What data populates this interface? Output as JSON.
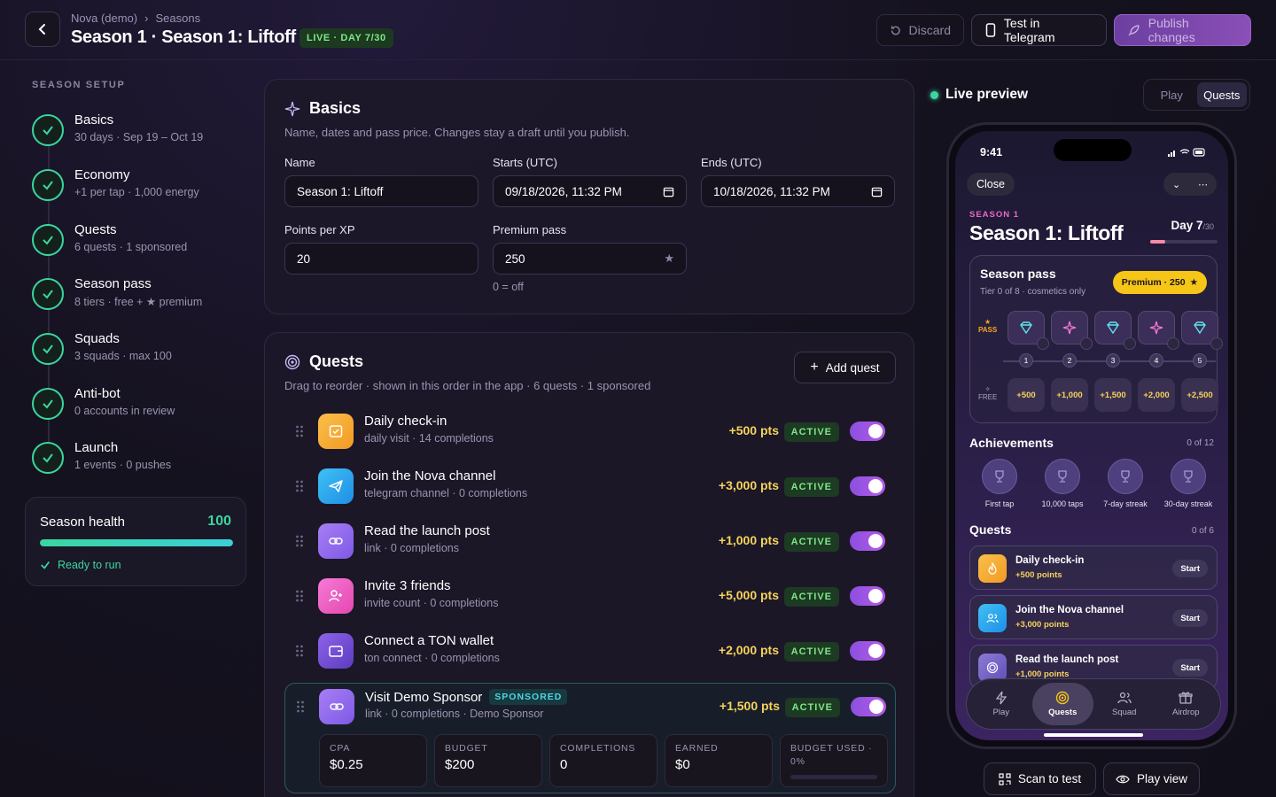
{
  "header": {
    "breadcrumb": [
      "Nova (demo)",
      "Seasons"
    ],
    "title": "Season 1 · Season 1: Liftoff",
    "status_badge": "LIVE · DAY 7/30",
    "discard_label": "Discard",
    "telegram_label": "Test in Telegram",
    "publish_label": "Publish changes"
  },
  "sidebar": {
    "section_label": "SEASON SETUP",
    "steps": [
      {
        "title": "Basics",
        "subtitle": "30 days · Sep 19 – Oct 19"
      },
      {
        "title": "Economy",
        "subtitle": "+1 per tap · 1,000 energy"
      },
      {
        "title": "Quests",
        "subtitle": "6 quests · 1 sponsored"
      },
      {
        "title": "Season pass",
        "subtitle": "8 tiers · free + ★ premium"
      },
      {
        "title": "Squads",
        "subtitle": "3 squads · max 100"
      },
      {
        "title": "Anti-bot",
        "subtitle": "0 accounts in review"
      },
      {
        "title": "Launch",
        "subtitle": "1 events · 0 pushes"
      }
    ],
    "health": {
      "label": "Season health",
      "value": "100",
      "progress": 1.0,
      "status": "Ready to run"
    }
  },
  "basics": {
    "title": "Basics",
    "subtitle": "Name, dates and pass price. Changes stay a draft until you publish.",
    "name_label": "Name",
    "name_value": "Season 1: Liftoff",
    "starts_label": "Starts (UTC)",
    "starts_value": "09/18/2026, 11:32 PM",
    "ends_label": "Ends (UTC)",
    "ends_value": "10/18/2026, 11:32 PM",
    "ppx_label": "Points per XP",
    "ppx_value": "20",
    "premium_label": "Premium pass",
    "premium_value": "250",
    "premium_hint": "0 = off"
  },
  "quests": {
    "title": "Quests",
    "subtitle": "Drag to reorder · shown in this order in the app · 6 quests · 1 sponsored",
    "add_label": "Add quest",
    "items": [
      {
        "title": "Daily check-in",
        "subtitle": "daily visit · 14 completions",
        "points": "+500 pts",
        "status": "ACTIVE",
        "icon": "calendar-icon",
        "color": "#f5a623"
      },
      {
        "title": "Join the Nova channel",
        "subtitle": "telegram channel · 0 completions",
        "points": "+3,000 pts",
        "status": "ACTIVE",
        "icon": "telegram-icon",
        "color": "#2ea6ef"
      },
      {
        "title": "Read the launch post",
        "subtitle": "link · 0 completions",
        "points": "+1,000 pts",
        "status": "ACTIVE",
        "icon": "link-icon",
        "color": "#9b6cf0"
      },
      {
        "title": "Invite 3 friends",
        "subtitle": "invite count · 0 completions",
        "points": "+5,000 pts",
        "status": "ACTIVE",
        "icon": "add-user-icon",
        "color": "#ef5dc0"
      },
      {
        "title": "Connect a TON wallet",
        "subtitle": "ton connect · 0 completions",
        "points": "+2,000 pts",
        "status": "ACTIVE",
        "icon": "wallet-icon",
        "color": "#7b4fd8"
      }
    ],
    "sponsored": {
      "title": "Visit Demo Sponsor",
      "tag": "SPONSORED",
      "subtitle": "link · 0 completions · Demo Sponsor",
      "points": "+1,500 pts",
      "status": "ACTIVE",
      "metrics": [
        {
          "label": "CPA",
          "value": "$0.25"
        },
        {
          "label": "BUDGET",
          "value": "$200"
        },
        {
          "label": "COMPLETIONS",
          "value": "0"
        },
        {
          "label": "EARNED",
          "value": "$0"
        },
        {
          "label": "BUDGET USED ·",
          "value": "0%"
        }
      ]
    }
  },
  "preview": {
    "label": "Live preview",
    "tabs": [
      "Play",
      "Quests"
    ],
    "active_tab": "Quests",
    "phone": {
      "time": "9:41",
      "close_label": "Close",
      "season_label": "SEASON 1",
      "title": "Season 1: Liftoff",
      "day": "Day 7",
      "day_total": "/30",
      "day_progress": 0.23,
      "pass": {
        "title": "Season pass",
        "subtitle": "Tier 0 of 8 · cosmetics only",
        "premium_pill": "Premium · 250",
        "pass_label": "PASS",
        "free_label": "FREE",
        "tiers": [
          "1",
          "2",
          "3",
          "4",
          "5"
        ],
        "free_rewards": [
          "+500",
          "+1,000",
          "+1,500",
          "+2,000",
          "+2,500"
        ]
      },
      "achievements_title": "Achievements",
      "achievements_count": "0 of 12",
      "achievements": [
        "First tap",
        "10,000 taps",
        "7-day streak",
        "30-day streak"
      ],
      "quests_title": "Quests",
      "quests_count": "0 of 6",
      "quests": [
        {
          "title": "Daily check-in",
          "points": "+500 points",
          "action": "Start",
          "color": "#f5a623"
        },
        {
          "title": "Join the Nova channel",
          "points": "+3,000 points",
          "action": "Start",
          "color": "#2ea6ef"
        },
        {
          "title": "Read the launch post",
          "points": "+1,000 points",
          "action": "Start",
          "color": "#7b6cc8"
        }
      ],
      "nav": [
        "Play",
        "Quests",
        "Squad",
        "Airdrop"
      ],
      "nav_active": "Quests"
    },
    "scan_label": "Scan to test",
    "play_view_label": "Play view"
  }
}
